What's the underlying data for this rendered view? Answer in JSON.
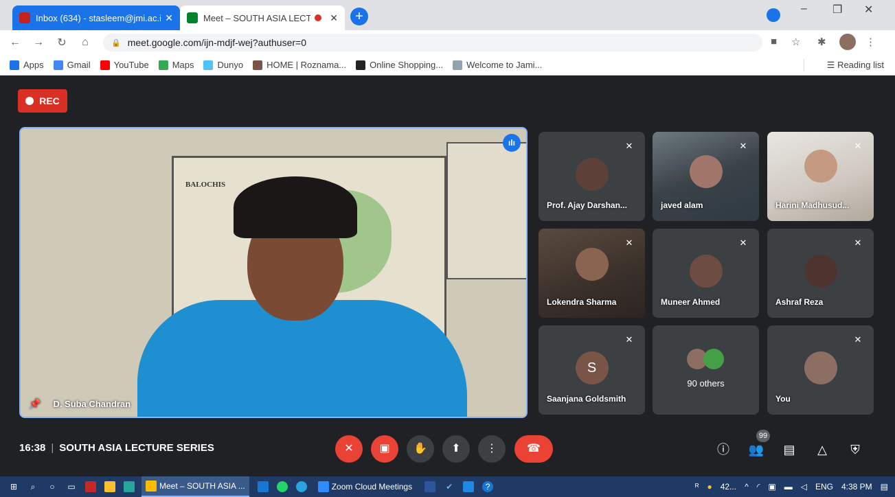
{
  "browser": {
    "tabs": [
      {
        "title": "Inbox (634) - stasleem@jmi.ac.i",
        "active": false
      },
      {
        "title": "Meet – SOUTH ASIA LECTU",
        "active": true
      }
    ],
    "url": "meet.google.com/ijn-mdjf-wej?authuser=0",
    "bookmarks": [
      "Apps",
      "Gmail",
      "YouTube",
      "Maps",
      "Dunyo",
      "HOME | Roznama...",
      "Online Shopping...",
      "Welcome to Jami..."
    ],
    "reading_list": "Reading list"
  },
  "meet": {
    "rec_label": "REC",
    "main_speaker": "D. Suba Chandran",
    "main_map_label": "BALOCHIS",
    "tiles": [
      {
        "name": "Prof. Ajay Darshan...",
        "kind": "avatar"
      },
      {
        "name": "javed alam",
        "kind": "video"
      },
      {
        "name": "Harini Madhusud...",
        "kind": "video"
      },
      {
        "name": "Lokendra Sharma",
        "kind": "video"
      },
      {
        "name": "Muneer Ahmed",
        "kind": "avatar"
      },
      {
        "name": "Ashraf Reza",
        "kind": "avatar"
      },
      {
        "name": "Saanjana Goldsmith",
        "kind": "initial",
        "initial": "S"
      },
      {
        "name": "90 others",
        "kind": "group"
      },
      {
        "name": "You",
        "kind": "avatar"
      }
    ],
    "time": "16:38",
    "meeting_title": "SOUTH ASIA LECTURE SERIES",
    "participant_count": "99"
  },
  "taskbar": {
    "apps": [
      "Meet – SOUTH ASIA ...",
      "Zoom Cloud Meetings"
    ],
    "tray": {
      "weather": "42...",
      "lang": "ENG",
      "time": "4:38 PM"
    }
  },
  "colors": {
    "accent": "#1a73e8",
    "danger": "#ea4335",
    "meet_bg": "#202124",
    "tile_bg": "#3c4043"
  }
}
